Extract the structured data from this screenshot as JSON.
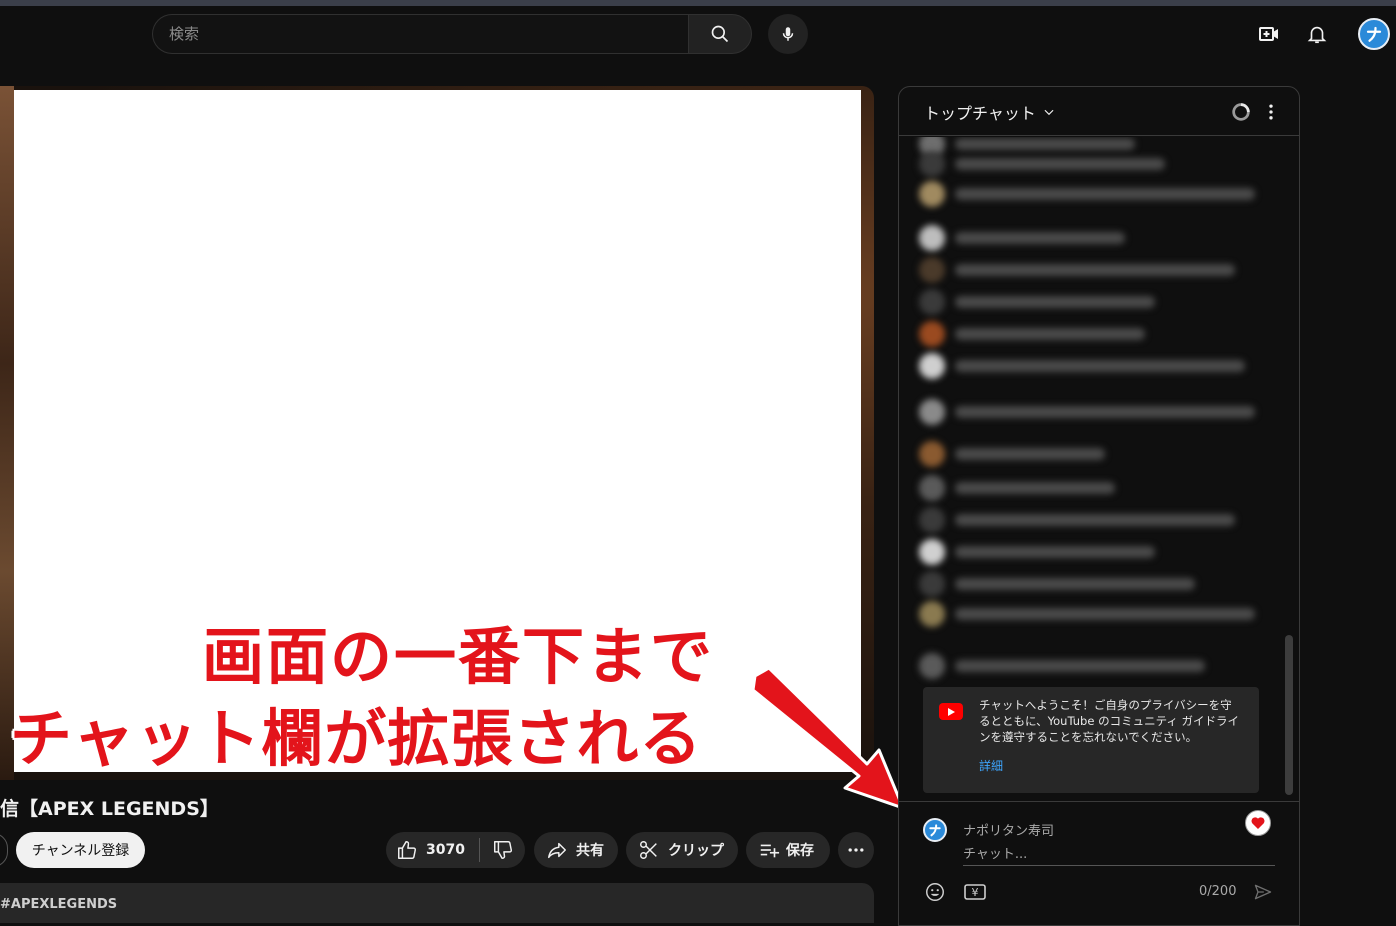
{
  "header": {
    "search_placeholder": "検索"
  },
  "video": {
    "title": "信【APEX LEGENDS】",
    "subscribe_label": "チャンネル登録",
    "like_count": "3070",
    "share_label": "共有",
    "clip_label": "クリップ",
    "save_label": "保存",
    "hashtag": "#APEXLEGENDS"
  },
  "annotation": {
    "line1": "画面の一番下まで",
    "line2": "チャット欄が拡張される",
    "color": "#e3141b"
  },
  "chat": {
    "title": "トップチャット",
    "welcome_text": "チャットへようこそ！ご自身のプライバシーを守るとともに、YouTube のコミュニティ ガイドラインを遵守することを忘れないでください。",
    "welcome_link": "詳細",
    "user_name": "ナポリタン寿司",
    "input_placeholder": "チャット...",
    "yen_label": "¥",
    "char_counter": "0/200"
  },
  "colors": {
    "background": "#0f0f0f",
    "pill": "#272727",
    "link": "#3ea6ff",
    "youtube_red": "#ff0000"
  }
}
